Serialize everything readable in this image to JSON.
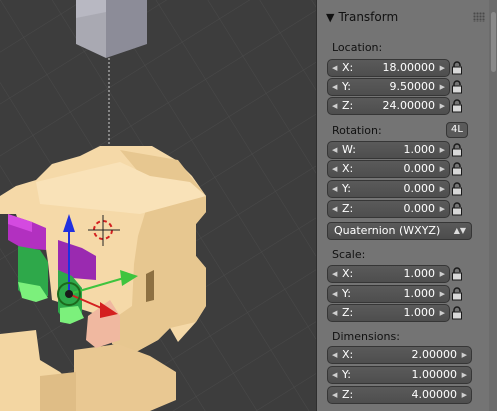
{
  "panel": {
    "title": "Transform",
    "collapse_icon": "disclosure-triangle-down-icon",
    "grip_icon": "drag-grip-icon"
  },
  "location": {
    "label": "Location:",
    "x": {
      "axis": "X:",
      "value": "18.00000"
    },
    "y": {
      "axis": "Y:",
      "value": "9.50000"
    },
    "z": {
      "axis": "Z:",
      "value": "24.00000"
    }
  },
  "rotation": {
    "label": "Rotation:",
    "lock_4l_label": "4L",
    "w": {
      "axis": "W:",
      "value": "1.000"
    },
    "x": {
      "axis": "X:",
      "value": "0.000"
    },
    "y": {
      "axis": "Y:",
      "value": "0.000"
    },
    "z": {
      "axis": "Z:",
      "value": "0.000"
    },
    "mode": "Quaternion (WXYZ)"
  },
  "scale": {
    "label": "Scale:",
    "x": {
      "axis": "X:",
      "value": "1.000"
    },
    "y": {
      "axis": "Y:",
      "value": "1.000"
    },
    "z": {
      "axis": "Z:",
      "value": "1.000"
    }
  },
  "dimensions": {
    "label": "Dimensions:",
    "x": {
      "axis": "X:",
      "value": "2.00000"
    },
    "y": {
      "axis": "Y:",
      "value": "1.00000"
    },
    "z": {
      "axis": "Z:",
      "value": "4.00000"
    }
  },
  "colors": {
    "panel_bg": "#747474",
    "field_bg": "#555555",
    "viewport_bg": "#3d3d3d",
    "skin": "#f5d9a8",
    "green": "#2ea84a",
    "purple": "#8a2aa0",
    "axis_x": "#d42020",
    "axis_y": "#3ec43e",
    "axis_z": "#2030e0"
  }
}
